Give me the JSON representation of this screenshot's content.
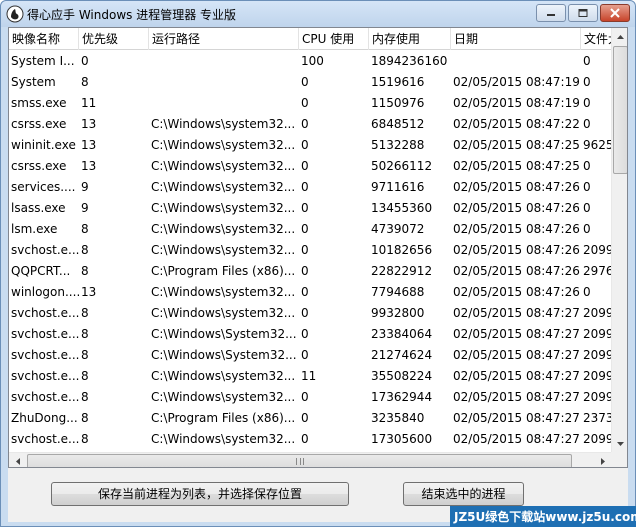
{
  "window": {
    "title": "得心应手 Windows 进程管理器 专业版",
    "icon": "app-hand-icon"
  },
  "columns": [
    "映像名称",
    "优先级",
    "运行路径",
    "CPU 使用",
    "内存使用",
    "日期",
    "文件大"
  ],
  "rows": [
    [
      "System I...",
      "0",
      "",
      "100",
      "1894236160",
      "",
      "0"
    ],
    [
      "System",
      "8",
      "",
      "0",
      "1519616",
      "02/05/2015 08:47:19",
      "0"
    ],
    [
      "smss.exe",
      "11",
      "",
      "0",
      "1150976",
      "02/05/2015 08:47:19",
      "0"
    ],
    [
      "csrss.exe",
      "13",
      "C:\\Windows\\system32...",
      "0",
      "6848512",
      "02/05/2015 08:47:22",
      "0"
    ],
    [
      "wininit.exe",
      "13",
      "C:\\Windows\\system32...",
      "0",
      "5132288",
      "02/05/2015 08:47:25",
      "9625"
    ],
    [
      "csrss.exe",
      "13",
      "C:\\Windows\\system32...",
      "0",
      "50266112",
      "02/05/2015 08:47:25",
      "0"
    ],
    [
      "services....",
      "9",
      "C:\\Windows\\system32...",
      "0",
      "9711616",
      "02/05/2015 08:47:26",
      "0"
    ],
    [
      "lsass.exe",
      "9",
      "C:\\Windows\\system32...",
      "0",
      "13455360",
      "02/05/2015 08:47:26",
      "0"
    ],
    [
      "lsm.exe",
      "8",
      "C:\\Windows\\system32...",
      "0",
      "4739072",
      "02/05/2015 08:47:26",
      "0"
    ],
    [
      "svchost.e...",
      "8",
      "C:\\Windows\\system32...",
      "0",
      "10182656",
      "02/05/2015 08:47:26",
      "2099"
    ],
    [
      "QQPCRT...",
      "8",
      "C:\\Program Files (x86)...",
      "0",
      "22822912",
      "02/05/2015 08:47:26",
      "2976"
    ],
    [
      "winlogon....",
      "13",
      "C:\\Windows\\system32...",
      "0",
      "7794688",
      "02/05/2015 08:47:26",
      "0"
    ],
    [
      "svchost.e...",
      "8",
      "C:\\Windows\\system32...",
      "0",
      "9932800",
      "02/05/2015 08:47:27",
      "2099"
    ],
    [
      "svchost.e...",
      "8",
      "C:\\Windows\\System32...",
      "0",
      "23384064",
      "02/05/2015 08:47:27",
      "2099"
    ],
    [
      "svchost.e...",
      "8",
      "C:\\Windows\\System32...",
      "0",
      "21274624",
      "02/05/2015 08:47:27",
      "2099"
    ],
    [
      "svchost.e...",
      "8",
      "C:\\Windows\\system32...",
      "11",
      "35508224",
      "02/05/2015 08:47:27",
      "2099"
    ],
    [
      "svchost.e...",
      "8",
      "C:\\Windows\\system32...",
      "0",
      "17362944",
      "02/05/2015 08:47:27",
      "2099"
    ],
    [
      "ZhuDong...",
      "8",
      "C:\\Program Files (x86)...",
      "0",
      "3235840",
      "02/05/2015 08:47:27",
      "2373"
    ],
    [
      "svchost.e...",
      "8",
      "C:\\Windows\\system32...",
      "0",
      "17305600",
      "02/05/2015 08:47:27",
      "2099"
    ]
  ],
  "buttons": {
    "save_label": "保存当前进程为列表，并选择保存位置",
    "end_label": "结束选中的进程"
  },
  "watermark": "JZ5U绿色下载站www.jz5u.com"
}
